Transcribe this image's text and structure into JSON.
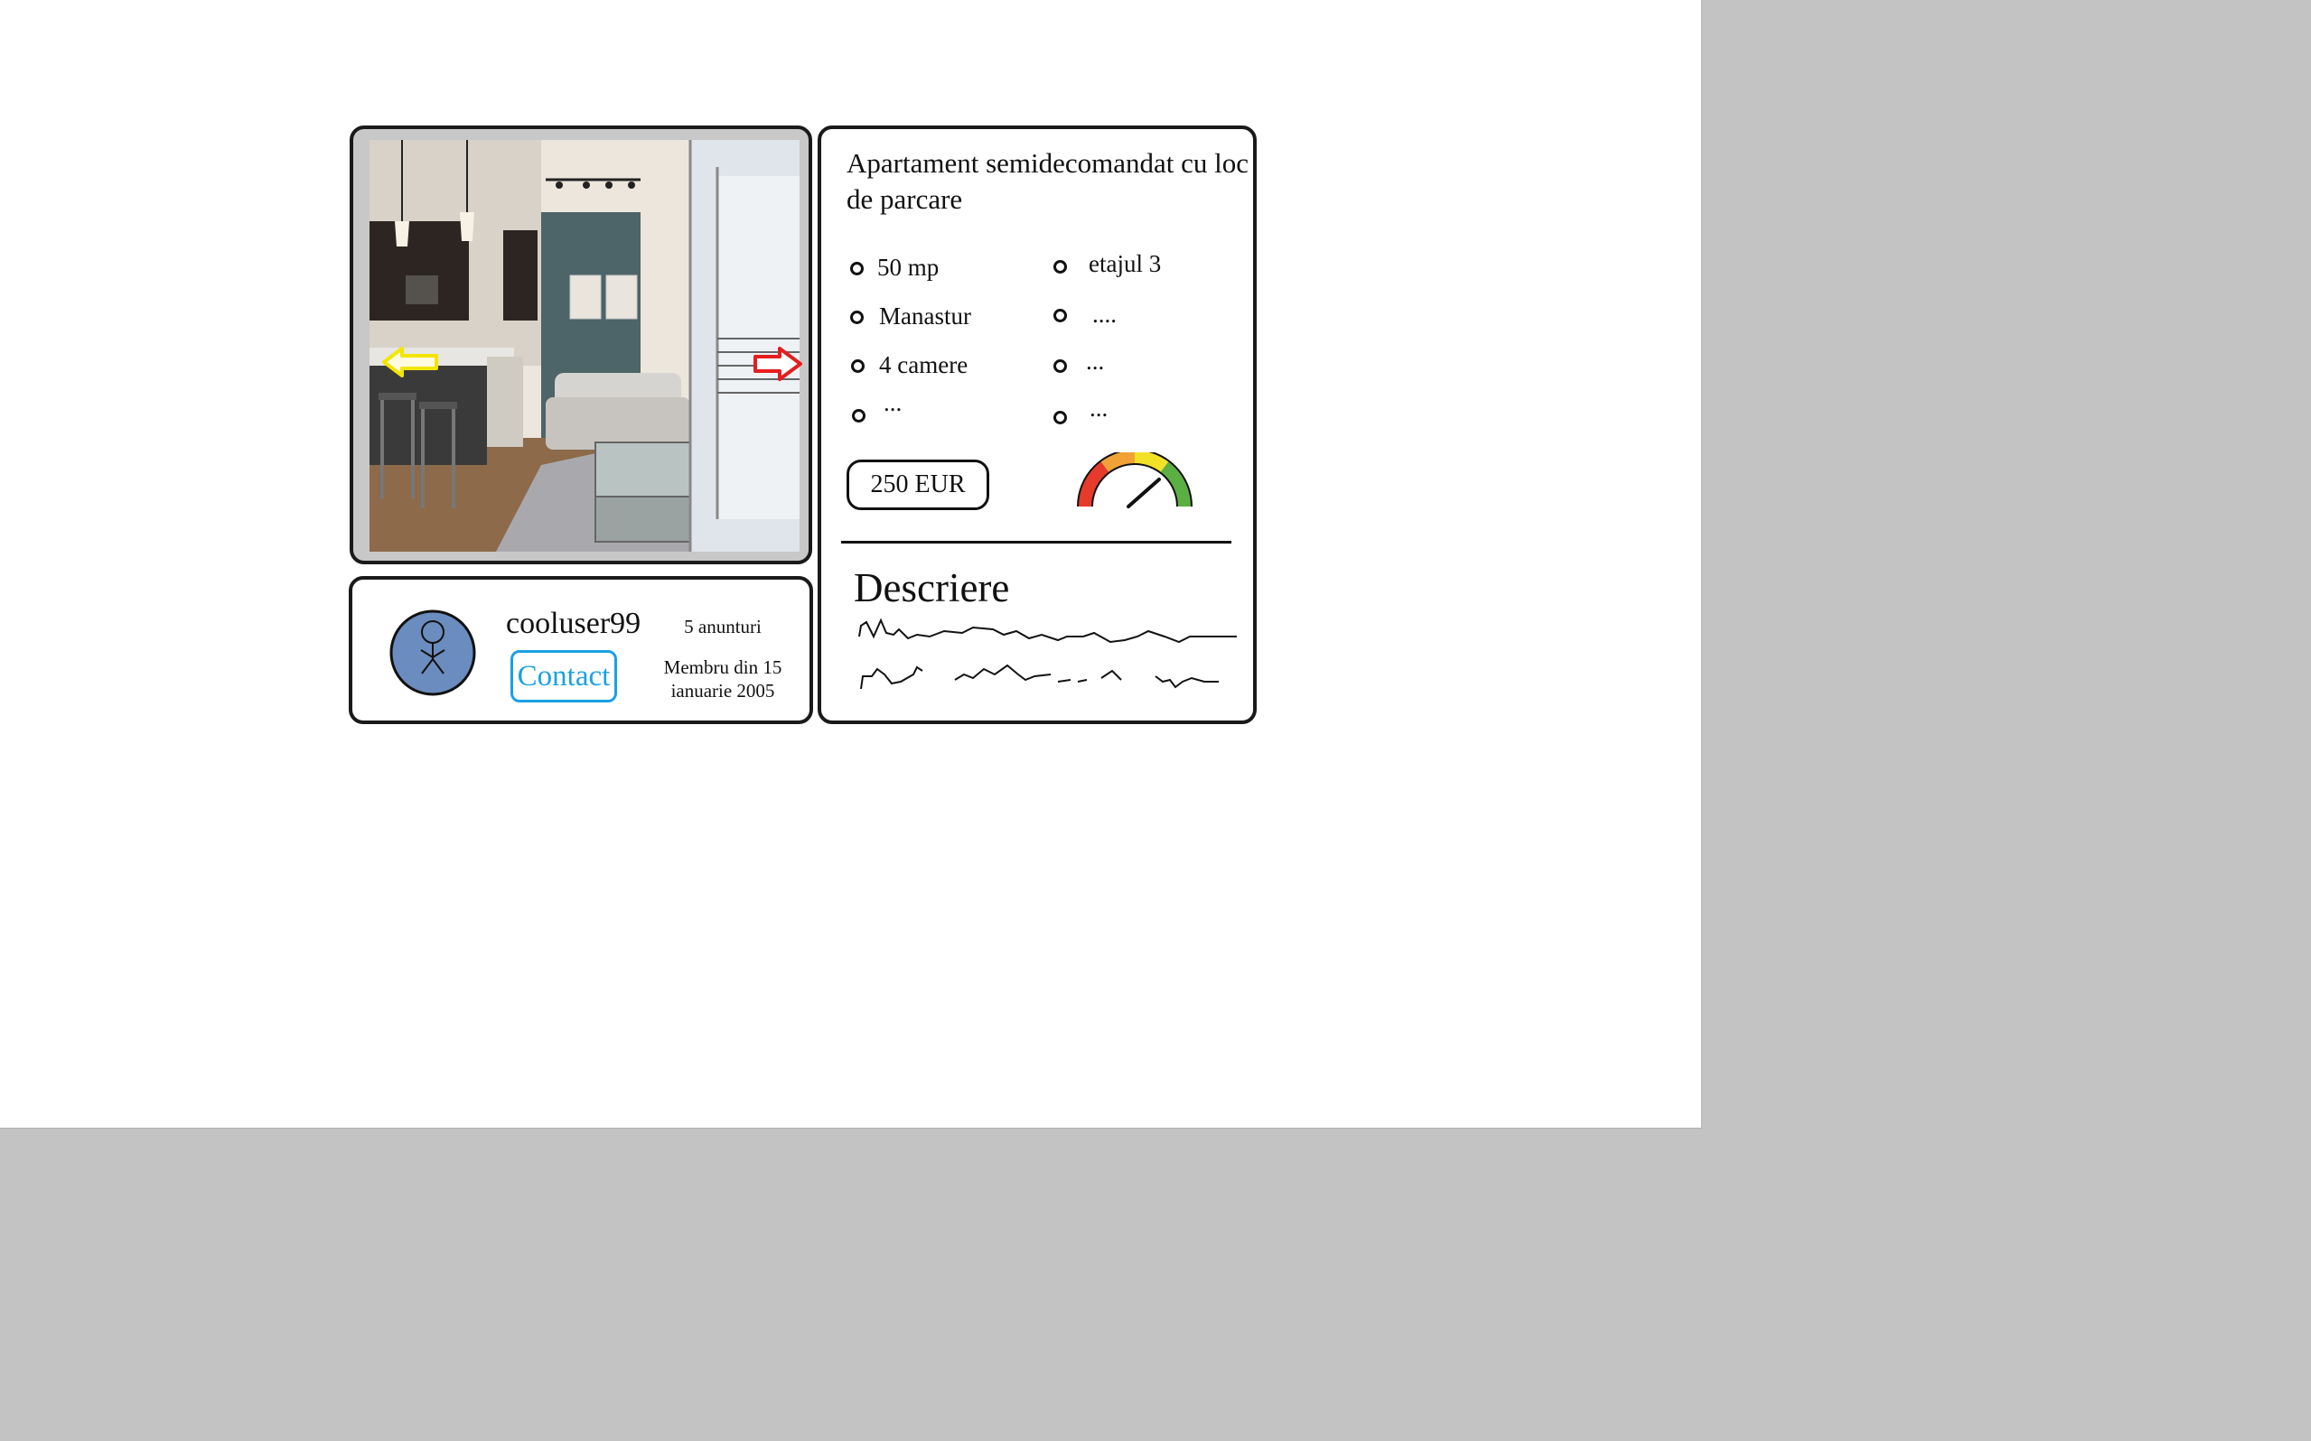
{
  "listing": {
    "title": "Apartament semidecomandat cu loc de parcare",
    "features_left": [
      "50 mp",
      "Manastur",
      "4 camere",
      "..."
    ],
    "features_right": [
      "etajul 3",
      "....",
      "...",
      "..."
    ],
    "price": "250 EUR",
    "description_heading": "Descriere"
  },
  "seller": {
    "username": "cooluser99",
    "contact_label": "Contact",
    "ads_count": "5 anunturi",
    "member_since_line1": "Membru din 15",
    "member_since_line2": "ianuarie 2005"
  },
  "icons": {
    "prev": "arrow-left-icon",
    "next": "arrow-right-icon",
    "avatar": "user-avatar-icon",
    "gauge": "price-gauge-icon"
  },
  "colors": {
    "contact": "#1ba1e2",
    "arrow_prev": "#f2e600",
    "arrow_next": "#e41e1e",
    "avatar_fill": "#6b8cbf"
  }
}
